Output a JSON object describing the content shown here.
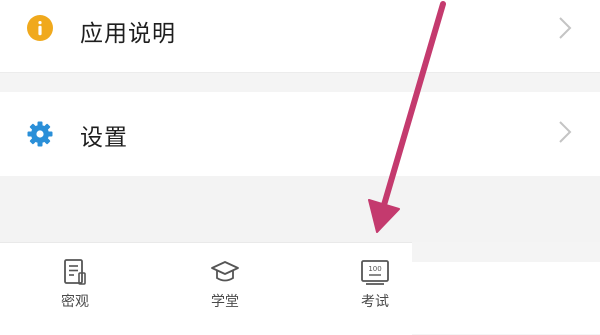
{
  "menu": {
    "items": [
      {
        "label": "应用说明",
        "icon": "info-icon",
        "icon_color": "#f0a91d"
      },
      {
        "label": "设置",
        "icon": "gear-icon",
        "icon_color": "#2a8fd8"
      }
    ]
  },
  "tabbar": {
    "tabs": [
      {
        "label": "密观",
        "icon": "document-icon"
      },
      {
        "label": "学堂",
        "icon": "graduation-cap-icon"
      },
      {
        "label": "考试",
        "icon": "exam-score-icon",
        "badge": "100"
      }
    ]
  },
  "colors": {
    "annotation_arrow": "#c43a6e",
    "chevron": "#c4c4c4",
    "tab_icon": "#555555"
  }
}
